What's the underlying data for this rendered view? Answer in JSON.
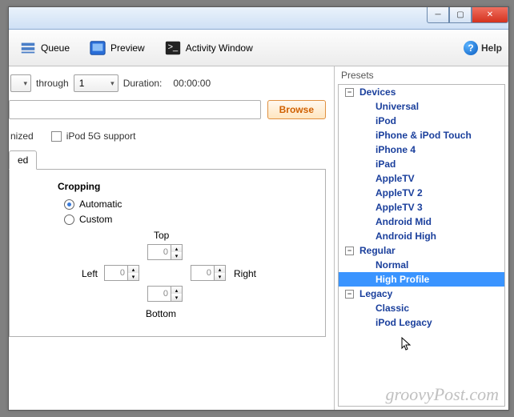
{
  "titlebar": {
    "title": ""
  },
  "toolbar": {
    "queue_label": "Queue",
    "preview_label": "Preview",
    "activity_label": "Activity Window",
    "help_label": "Help"
  },
  "duration": {
    "through_label": "through",
    "combo_value": "1",
    "duration_label": "Duration:",
    "duration_value": "00:00:00"
  },
  "browse_label": "Browse",
  "ipod_support_label": "iPod 5G support",
  "nized_label": "nized",
  "tab_ed_label": "ed",
  "cropping": {
    "heading": "Cropping",
    "auto_label": "Automatic",
    "custom_label": "Custom",
    "top_label": "Top",
    "left_label": "Left",
    "right_label": "Right",
    "bottom_label": "Bottom",
    "top_val": "0",
    "left_val": "0",
    "right_val": "0",
    "bottom_val": "0"
  },
  "presets": {
    "panel_label": "Presets",
    "groups": [
      {
        "name": "Devices",
        "expanded": true,
        "items": [
          "Universal",
          "iPod",
          "iPhone & iPod Touch",
          "iPhone 4",
          "iPad",
          "AppleTV",
          "AppleTV 2",
          "AppleTV 3",
          "Android Mid",
          "Android High"
        ]
      },
      {
        "name": "Regular",
        "expanded": true,
        "items": [
          "Normal",
          "High Profile"
        ]
      },
      {
        "name": "Legacy",
        "expanded": true,
        "items": [
          "Classic",
          "iPod Legacy"
        ]
      }
    ],
    "selected": "High Profile"
  },
  "watermark": "groovyPost.com"
}
